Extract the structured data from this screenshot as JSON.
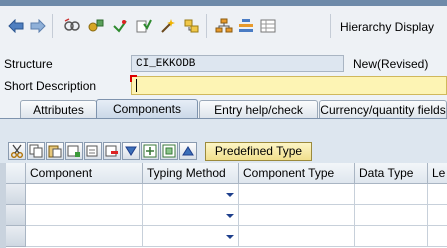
{
  "toolbar": {
    "icons": [
      "back-arrow-icon",
      "forward-arrow-icon",
      "other-object-icon",
      "display-change-icon",
      "activate-icon",
      "check-icon",
      "test-icon",
      "where-used-icon",
      "hierarchy-tree-icon",
      "details-icon",
      "object-list-icon"
    ],
    "hierarchy_display_label": "Hierarchy Display"
  },
  "form": {
    "structure_label": "Structure",
    "structure_value": "CI_EKKODB",
    "structure_state": "New(Revised)",
    "short_description_label": "Short Description",
    "short_description_value": ""
  },
  "tabs": [
    {
      "label": "Attributes",
      "active": false
    },
    {
      "label": "Components",
      "active": true
    },
    {
      "label": "Entry help/check",
      "active": false
    },
    {
      "label": "Currency/quantity fields",
      "active": false
    }
  ],
  "table_toolbar": {
    "icons": [
      "cut-icon",
      "copy-icon",
      "paste-icon",
      "insert-row-icon",
      "delete-row-icon",
      "expand-icon",
      "fields-icon",
      "nested-icon",
      "collapse-icon"
    ],
    "predefined_type_label": "Predefined Type"
  },
  "grid": {
    "columns": [
      "Component",
      "Typing Method",
      "Component Type",
      "Data Type",
      "Le"
    ],
    "rows": [
      {
        "component": "",
        "typing_method": "",
        "component_type": "",
        "data_type": ""
      },
      {
        "component": "",
        "typing_method": "",
        "component_type": "",
        "data_type": ""
      },
      {
        "component": "",
        "typing_method": "",
        "component_type": "",
        "data_type": ""
      }
    ]
  },
  "colors": {
    "input_required_bg": "#fdf4b4",
    "readonly_field_bg": "#dde6f0",
    "tab_active": "#c9d7e7",
    "predefined_btn": "#f1df8d"
  }
}
